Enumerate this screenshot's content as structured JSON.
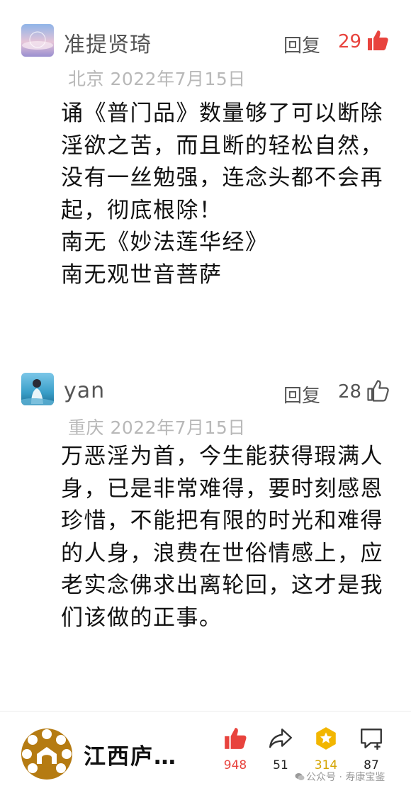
{
  "comments": [
    {
      "username": "准提贤琦",
      "reply_label": "回复",
      "likes": "29",
      "liked": true,
      "location": "北京",
      "date": "2022年7月15日",
      "lines": [
        "诵《普门品》数量够了可以断除淫欲之苦，而且断的轻松自然，没有一丝勉强，连念头都不会再起，彻底根除！",
        "南无《妙法莲华经》",
        "南无观世音菩萨"
      ]
    },
    {
      "username": "yan",
      "reply_label": "回复",
      "likes": "28",
      "liked": false,
      "location": "重庆",
      "date": "2022年7月15日",
      "lines": [
        "万恶淫为首，今生能获得瑕满人身，已是非常难得，要时刻感恩珍惜，不能把有限的时光和难得的人身，浪费在世俗情感上，应老实念佛求出离轮回，这才是我们该做的正事。"
      ]
    }
  ],
  "bottom_bar": {
    "account_name": "江西庐…",
    "like_count": "948",
    "share_count": "51",
    "star_count": "314",
    "comment_count": "87",
    "watermark": "公众号 · 寿康宝鉴"
  },
  "icons": {
    "like": "thumbs-up-icon",
    "share": "share-arrow-icon",
    "star": "hexagon-star-icon",
    "comment": "add-comment-icon"
  },
  "colors": {
    "like_red": "#e8433d",
    "star_gold": "#f2b600",
    "meta_gray": "#b8b8b8",
    "text_dark": "#111111"
  }
}
